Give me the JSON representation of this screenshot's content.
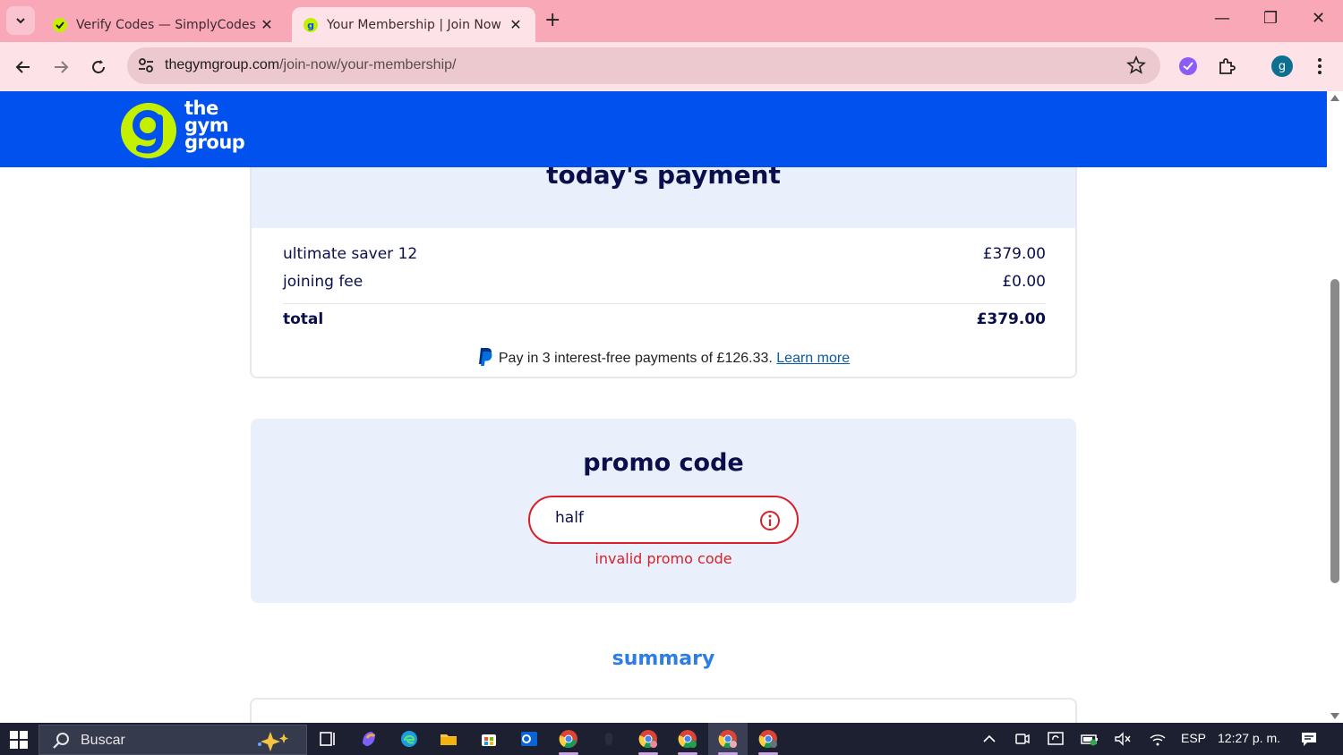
{
  "browser": {
    "tabs": [
      {
        "title": "Verify Codes — SimplyCodes",
        "active": false
      },
      {
        "title": "Your Membership | Join Now | T",
        "active": true
      }
    ],
    "url_host": "thegymgroup.com",
    "url_path": "/join-now/your-membership/",
    "profile_initial": "g"
  },
  "site": {
    "logo_lines": [
      "the",
      "gym",
      "group"
    ]
  },
  "payment": {
    "title": "today's payment",
    "lines": [
      {
        "label": "ultimate saver 12",
        "amount": "£379.00"
      },
      {
        "label": "joining fee",
        "amount": "£0.00"
      }
    ],
    "total_label": "total",
    "total_amount": "£379.00",
    "paypal_text": "Pay in 3 interest-free payments of £126.33.",
    "paypal_link": "Learn more"
  },
  "promo": {
    "title": "promo code",
    "value": "half",
    "error": "invalid promo code"
  },
  "summary": {
    "title": "summary"
  },
  "taskbar": {
    "search_label": "Buscar",
    "language": "ESP",
    "time": "12:27 p. m."
  },
  "colors": {
    "header_blue": "#0051ee",
    "brand_green": "#c4f000",
    "navy_text": "#0a0f4c",
    "error_red": "#d6202a",
    "summary_blue": "#2e7de5",
    "card_bg": "#e9f0fb"
  }
}
